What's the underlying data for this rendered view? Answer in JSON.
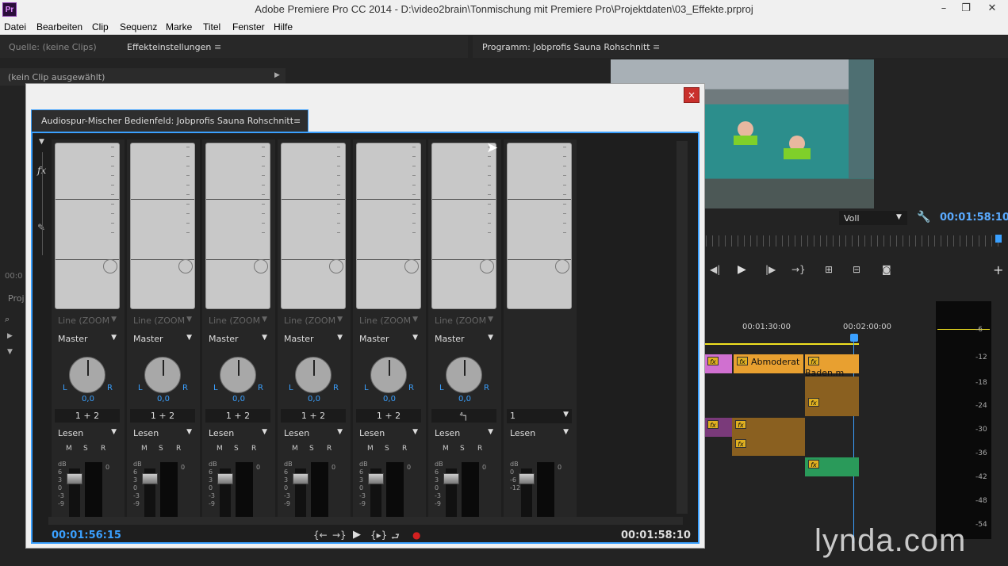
{
  "window": {
    "title": "Adobe Premiere Pro CC 2014 - D:\\video2brain\\Tonmischung mit Premiere Pro\\Projektdaten\\03_Effekte.prproj",
    "logo": "Pr",
    "min_icon": "minimize-icon",
    "max_icon": "maximize-icon",
    "close_icon": "close-icon"
  },
  "menu": [
    "Datei",
    "Bearbeiten",
    "Clip",
    "Sequenz",
    "Marke",
    "Titel",
    "Fenster",
    "Hilfe"
  ],
  "source_panel": {
    "tab_source": "Quelle: (keine Clips)",
    "tab_effects": "Effekteinstellungen",
    "no_clip": "(kein Clip ausgewählt)",
    "timecode_fragment": "00:0",
    "project_fragment": "Proj"
  },
  "program_panel": {
    "tab": "Programm: Jobprofis Sauna Rohschnitt",
    "quality": "Voll",
    "timecode": "00:01:58:10"
  },
  "mixer": {
    "tab": "Audiospur-Mischer Bedienfeld: Jobprofis Sauna Rohschnitt",
    "close": "×",
    "fx_label": "fx",
    "time_left": "00:01:56:15",
    "time_right": "00:01:58:10",
    "channels": [
      {
        "input": "Line (ZOOM",
        "output": "Master",
        "pan": "0,0",
        "routing": "1 + 2",
        "mode": "Lesen",
        "m": "M",
        "s": "S",
        "r": "R"
      },
      {
        "input": "Line (ZOOM",
        "output": "Master",
        "pan": "0,0",
        "routing": "1 + 2",
        "mode": "Lesen",
        "m": "M",
        "s": "S",
        "r": "R"
      },
      {
        "input": "Line (ZOOM",
        "output": "Master",
        "pan": "0,0",
        "routing": "1 + 2",
        "mode": "Lesen",
        "m": "M",
        "s": "S",
        "r": "R"
      },
      {
        "input": "Line (ZOOM",
        "output": "Master",
        "pan": "0,0",
        "routing": "1 + 2",
        "mode": "Lesen",
        "m": "M",
        "s": "S",
        "r": "R"
      },
      {
        "input": "Line (ZOOM",
        "output": "Master",
        "pan": "0,0",
        "routing": "1 + 2",
        "mode": "Lesen",
        "m": "M",
        "s": "S",
        "r": "R"
      },
      {
        "input": "Line (ZOOM",
        "output": "Master",
        "pan": "0,0",
        "routing": "⁴┐",
        "mode": "Lesen",
        "m": "M",
        "s": "S",
        "r": "R"
      }
    ],
    "master": {
      "routing": "1",
      "mode": "Lesen"
    },
    "scale_db": "dB",
    "scale": [
      "6",
      "3",
      "0",
      "-3",
      "-9"
    ],
    "master_scale": [
      "0",
      "-6",
      "-12"
    ],
    "zero": "0",
    "l": "L",
    "r_lbl": "R"
  },
  "timeline": {
    "time1": "00:01:30:00",
    "time2": "00:02:00:00",
    "clip_abmod": "Abmoderat",
    "clip_baden": "Baden.m",
    "fx": "fx"
  },
  "right_meter": [
    "-6",
    "-12",
    "-18",
    "-24",
    "-30",
    "-36",
    "-42",
    "-48",
    "-54"
  ],
  "watermark": "lynda.com"
}
